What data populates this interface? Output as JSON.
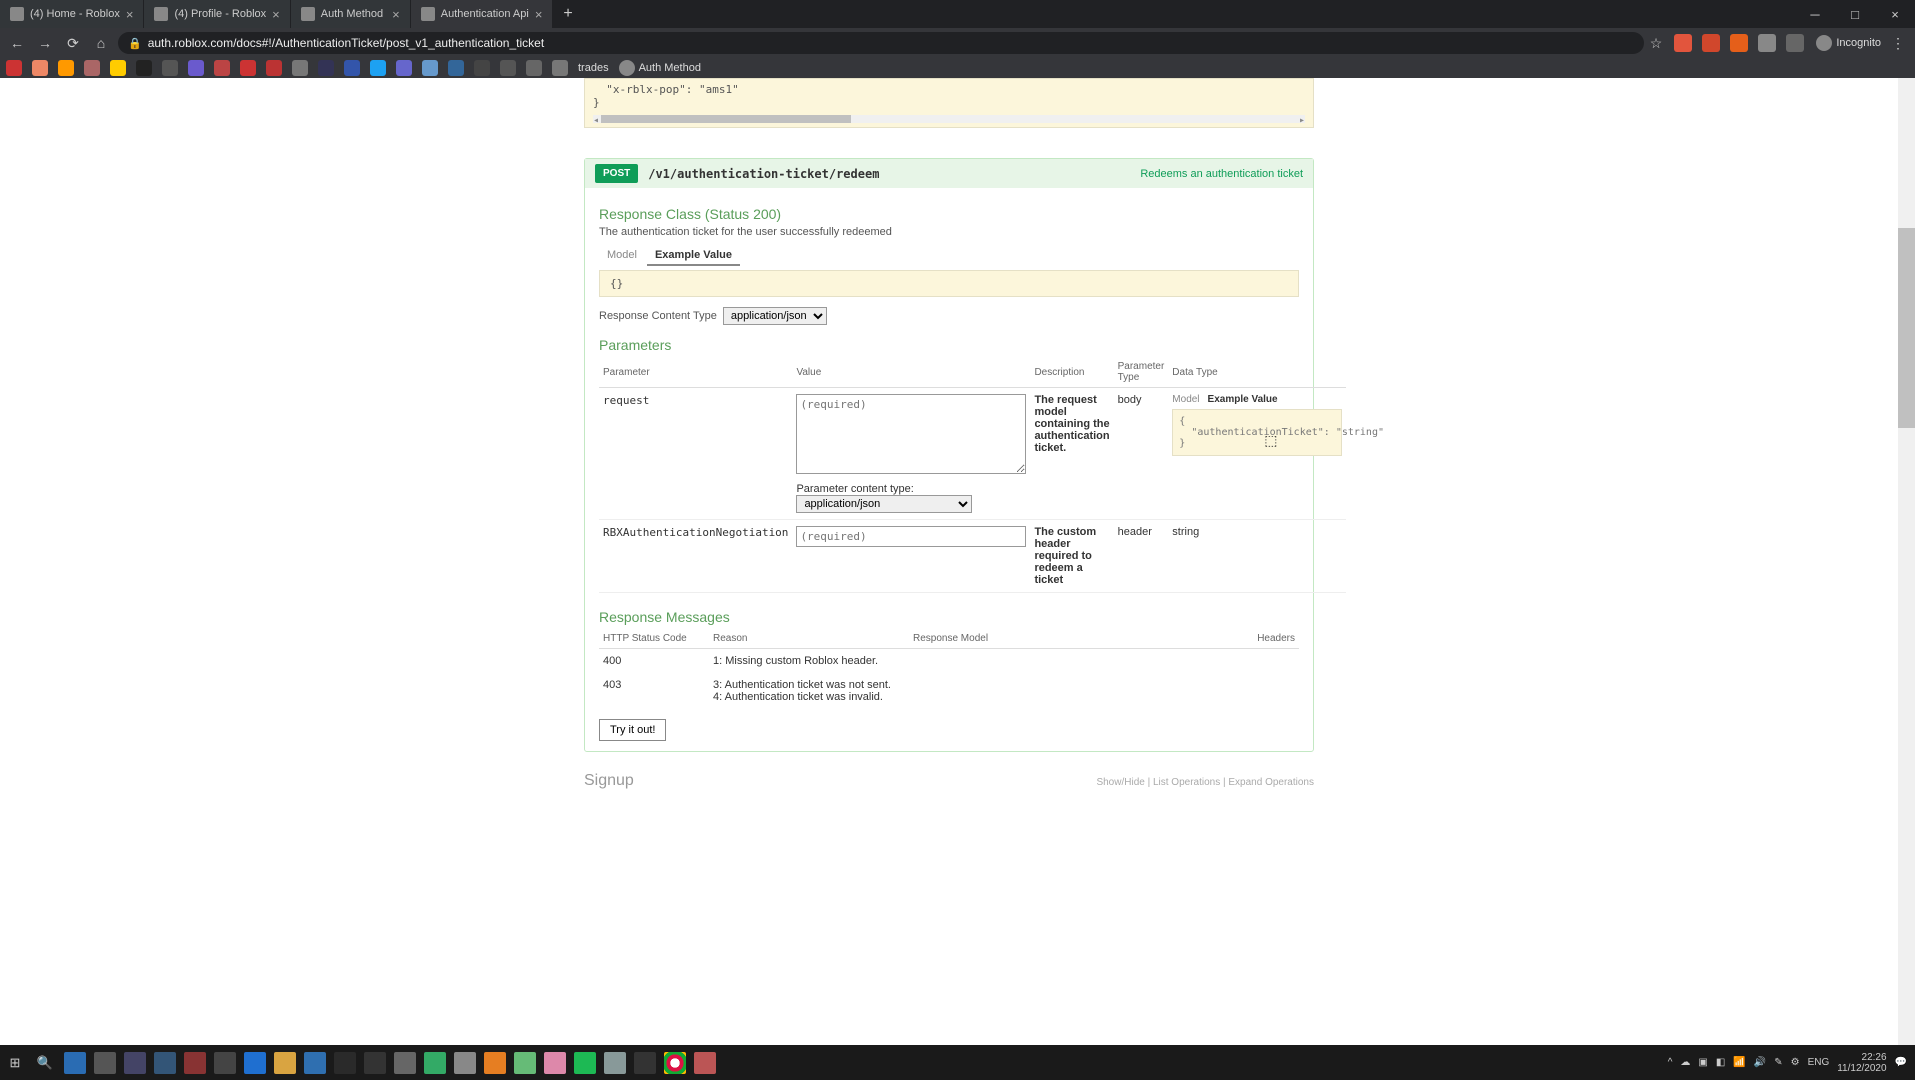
{
  "browser": {
    "tabs": [
      {
        "title": "(4) Home - Roblox"
      },
      {
        "title": "(4) Profile - Roblox"
      },
      {
        "title": "Auth Method"
      },
      {
        "title": "Authentication Api",
        "active": true
      }
    ],
    "url": "auth.roblox.com/docs#!/AuthenticationTicket/post_v1_authentication_ticket",
    "incognito": "Incognito",
    "bookmarks": [
      {
        "label": "trades"
      },
      {
        "label": "Auth Method"
      }
    ]
  },
  "code_snippet": {
    "line": "\"x-rblx-pop\": \"ams1\"",
    "close": "}"
  },
  "op": {
    "method": "POST",
    "path": "/v1/authentication-ticket/redeem",
    "desc": "Redeems an authentication ticket"
  },
  "response": {
    "title": "Response Class (Status 200)",
    "subtitle": "The authentication ticket for the user successfully redeemed",
    "model": "Model",
    "example": "Example Value",
    "body": "{}",
    "content_type_label": "Response Content Type",
    "content_type": "application/json"
  },
  "params": {
    "title": "Parameters",
    "headers": {
      "p": "Parameter",
      "v": "Value",
      "d": "Description",
      "t": "Parameter Type",
      "dt": "Data Type"
    },
    "row1": {
      "name": "request",
      "placeholder": "(required)",
      "desc": "The request model containing the authentication ticket.",
      "ptype": "body",
      "model": "Model",
      "example": "Example Value",
      "example_body": "{\n  \"authenticationTicket\": \"string\"\n}",
      "pct_label": "Parameter content type:",
      "pct": "application/json"
    },
    "row2": {
      "name": "RBXAuthenticationNegotiation",
      "placeholder": "(required)",
      "desc": "The custom header required to redeem a ticket",
      "ptype": "header",
      "dtype": "string"
    }
  },
  "resp_msgs": {
    "title": "Response Messages",
    "headers": {
      "code": "HTTP Status Code",
      "reason": "Reason",
      "model": "Response Model",
      "hdr": "Headers"
    },
    "rows": [
      {
        "code": "400",
        "reason": "1: Missing custom Roblox header."
      },
      {
        "code": "403",
        "reason": "3: Authentication ticket was not sent.\n4: Authentication ticket was invalid."
      }
    ]
  },
  "try": "Try it out!",
  "signup": "Signup",
  "footlinks": "Show/Hide  |  List Operations  |  Expand Operations",
  "tray": {
    "lang": "ENG",
    "time": "22:26",
    "date": "11/12/2020"
  }
}
